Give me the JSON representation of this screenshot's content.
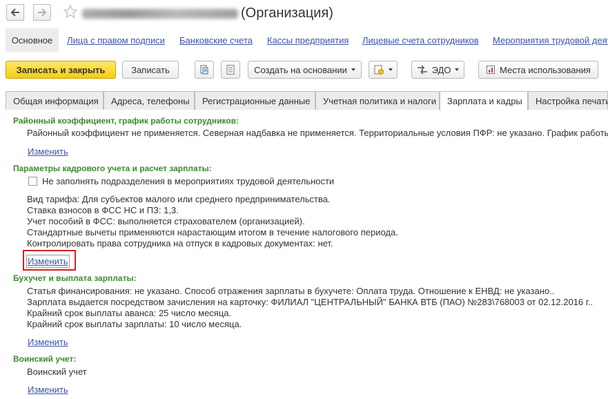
{
  "window": {
    "title_suffix": "(Организация)"
  },
  "formnav": {
    "active": "Основное",
    "links": [
      "Лица с правом подписи",
      "Банковские счета",
      "Кассы предприятия",
      "Лицевые счета сотрудников",
      "Мероприятия трудовой деят"
    ]
  },
  "toolbar": {
    "save_close": "Записать и закрыть",
    "save": "Записать",
    "create_based": "Создать на основании",
    "edo": "ЭДО",
    "usage": "Места использования"
  },
  "tabs": [
    "Общая информация",
    "Адреса, телефоны",
    "Регистрационные данные",
    "Учетная политика и налоги",
    "Зарплата и кадры",
    "Настройка печати"
  ],
  "active_tab": "Зарплата и кадры",
  "sections": {
    "district": {
      "title": "Районный коэффициент, график работы сотрудников:",
      "text": "Районный коэффициент не применяется. Северная надбавка не применяется. Территориальные условия ПФР: не указано. График работы с",
      "link": "Изменить"
    },
    "hr": {
      "title": "Параметры кадрового учета и расчет зарплаты:",
      "checkbox_label": "Не заполнять подразделения в мероприятиях трудовой деятельности",
      "checkbox_checked": false,
      "lines": [
        "Вид тарифа: Для субъектов малого или среднего предпринимательства.",
        " Ставка взносов в ФСС НС и ПЗ: 1,3.",
        "Учет пособий в ФСС: выполняется страхователем (организацией).",
        "Стандартные вычеты применяются нарастающим итогом в течение налогового периода.",
        "Контролировать права сотрудника на отпуск в кадровых документах: нет."
      ],
      "link": "Изменить"
    },
    "accounting": {
      "title": "Бухучет и выплата зарплаты:",
      "lines": [
        "Статья финансирования: не указано. Способ отражения зарплаты в бухучете: Оплата труда. Отношение к ЕНВД: не указано..",
        "Зарплата выдается посредством зачисления на карточку: ФИЛИАЛ \"ЦЕНТРАЛЬНЫЙ\" БАНКА ВТБ (ПАО) №283\\768003 от 02.12.2016 г..",
        "Крайний срок выплаты аванса: 25 число месяца.",
        "Крайний срок выплаты зарплаты: 10 число месяца."
      ],
      "link": "Изменить"
    },
    "military": {
      "title": "Воинский учет:",
      "text": "Воинский учет",
      "link": "Изменить"
    }
  },
  "icons": {
    "back": "arrow-left-icon",
    "forward": "arrow-right-icon",
    "favorite": "star-icon",
    "print": "print-icon",
    "list": "list-icon",
    "attach": "report-icon",
    "edo": "edo-icon",
    "usage": "usage-icon"
  },
  "colors": {
    "primary_button": "#f6cc13",
    "section_title": "#3a8a2e",
    "link": "#3b53a7",
    "highlight_frame": "#d02020"
  }
}
